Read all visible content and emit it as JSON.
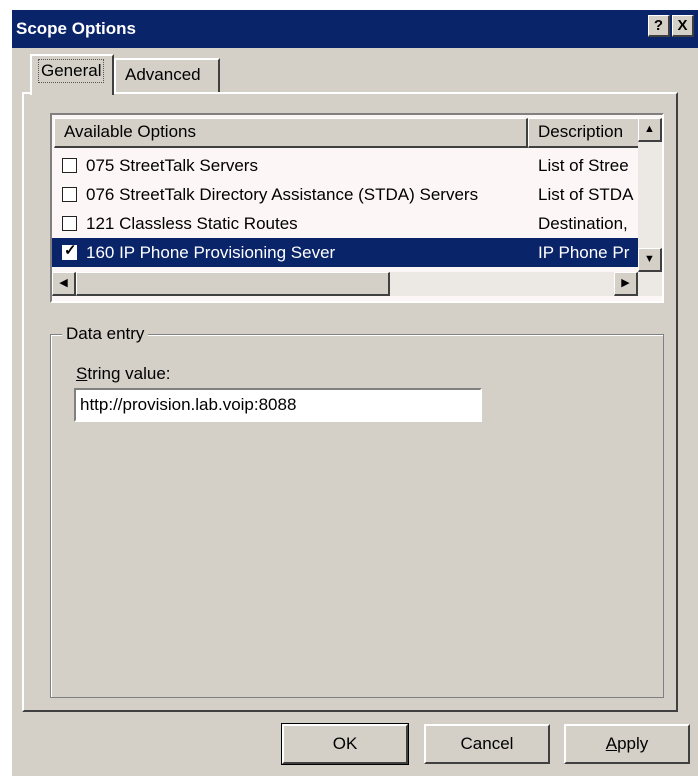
{
  "window": {
    "title": "Scope Options",
    "help_glyph": "?",
    "close_glyph": "X"
  },
  "tabs": [
    {
      "label": "General",
      "active": true
    },
    {
      "label": "Advanced",
      "active": false
    }
  ],
  "options_list": {
    "columns": [
      "Available Options",
      "Description"
    ],
    "rows": [
      {
        "name": "075 StreetTalk Servers",
        "description": "List of Stree",
        "checked": false,
        "selected": false
      },
      {
        "name": "076 StreetTalk Directory Assistance (STDA) Servers",
        "description": "List of STDA",
        "checked": false,
        "selected": false
      },
      {
        "name": "121 Classless Static Routes",
        "description": "Destination,",
        "checked": false,
        "selected": false
      },
      {
        "name": "160 IP Phone Provisioning Sever",
        "description": "IP Phone Pr",
        "checked": true,
        "selected": true
      }
    ]
  },
  "data_entry": {
    "group_label": "Data entry",
    "field_label_access": "S",
    "field_label_rest": "tring value:",
    "string_value": "http://provision.lab.voip:8088"
  },
  "buttons": {
    "ok": "OK",
    "cancel": "Cancel",
    "apply_access": "A",
    "apply_rest": "pply"
  },
  "icons": {
    "scroll_up": "up-arrow-icon",
    "scroll_down": "down-arrow-icon",
    "scroll_left": "left-arrow-icon",
    "scroll_right": "right-arrow-icon",
    "check": "checkmark-icon"
  }
}
